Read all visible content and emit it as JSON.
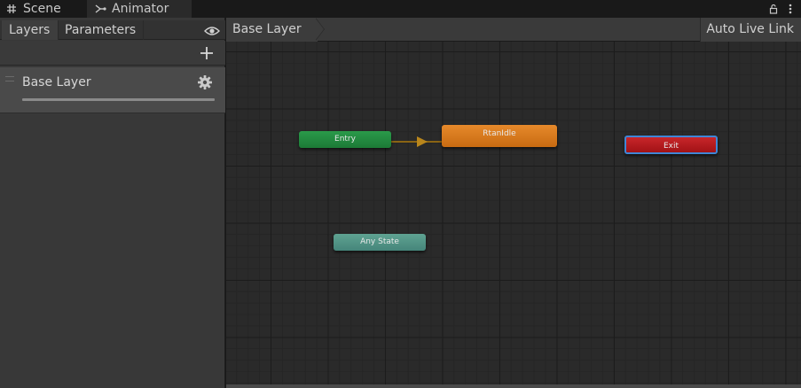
{
  "tabs": [
    {
      "label": "Scene",
      "icon": "grid-icon"
    },
    {
      "label": "Animator",
      "icon": "animator-icon"
    }
  ],
  "left_panel": {
    "tabs": [
      "Layers",
      "Parameters"
    ],
    "layers": [
      {
        "name": "Base Layer"
      }
    ]
  },
  "graph": {
    "breadcrumb": "Base Layer",
    "live_link_label": "Auto Live Link",
    "states": {
      "entry": "Entry",
      "idle": "RtanIdle",
      "exit": "Exit",
      "any": "Any State"
    }
  },
  "colors": {
    "entry": "#1c7a36",
    "default_state": "#c86b12",
    "exit": "#a11216",
    "any_state": "#45857a",
    "transition": "#8a6414",
    "selection": "#3f86d6"
  }
}
